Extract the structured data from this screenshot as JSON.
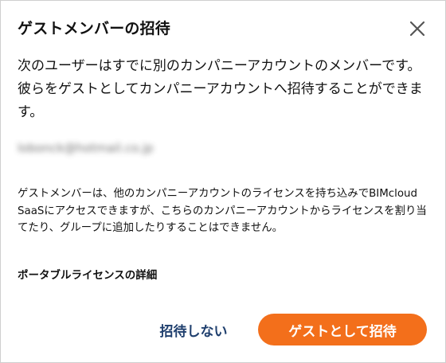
{
  "dialog": {
    "title": "ゲストメンバーの招待",
    "intro_text": "次のユーザーはすでに別のカンパニーアカウントのメンバーです。彼らをゲストとしてカンパニーアカウントへ招待することができます。",
    "email": "lobonck@hotmail.co.jp",
    "note_text": "ゲストメンバーは、他のカンパニーアカウントのライセンスを持ち込みでBIMcloud SaaSにアクセスできますが、こちらのカンパニーアカウントからライセンスを割り当てたり、グループに追加したりすることはできません。",
    "details_link": "ポータブルライセンスの詳細",
    "cancel_label": "招待しない",
    "confirm_label": "ゲストとして招待"
  },
  "colors": {
    "primary": "#f36f1b",
    "secondary_text": "#1f3f6e",
    "close_icon": "#555555"
  },
  "icons": {
    "close": "close-icon"
  }
}
